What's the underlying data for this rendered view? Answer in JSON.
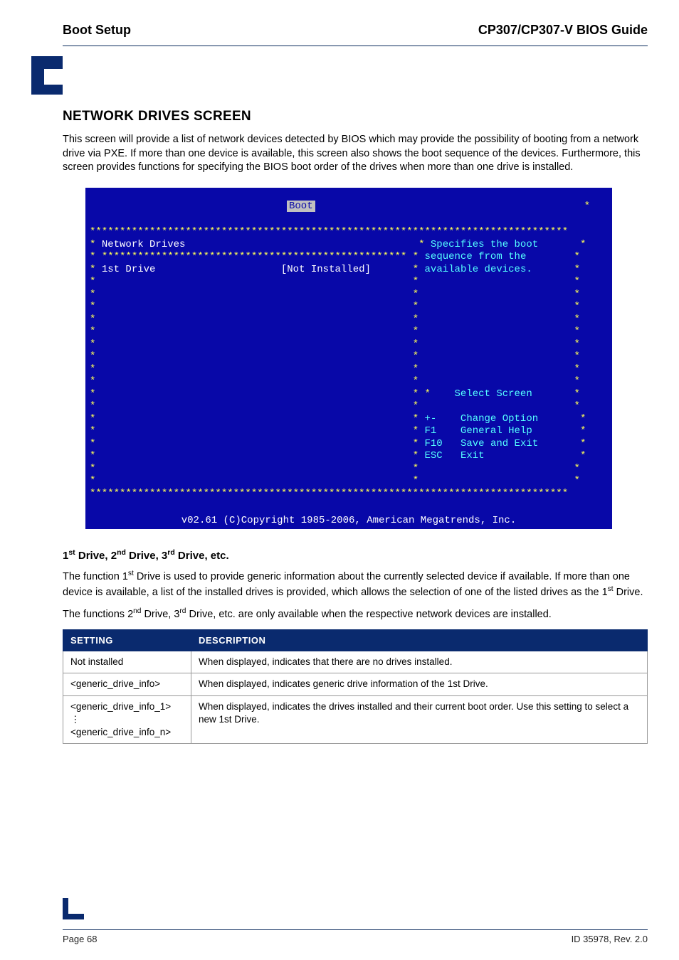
{
  "header": {
    "left": "Boot Setup",
    "right": "CP307/CP307-V BIOS Guide"
  },
  "section": {
    "title": "NETWORK DRIVES SCREEN",
    "intro": "This screen will provide a list of network devices detected by BIOS which may provide the possibility of booting from a network drive via PXE. If more than one device is available, this screen also shows the boot sequence of the devices. Furthermore, this screen provides functions for specifying the BIOS boot order of the drives when more than one drive is installed."
  },
  "bios": {
    "tab": "Boot",
    "panel_title": "Network Drives",
    "option_label": "1st Drive",
    "option_value": "[Not Installed]",
    "help1": "Specifies the boot",
    "help2": "sequence from the",
    "help3": "available devices.",
    "nav1": "Select Screen",
    "nav2_key": "+-",
    "nav2": "Change Option",
    "nav3_key": "F1",
    "nav3": "General Help",
    "nav4_key": "F10",
    "nav4": "Save and Exit",
    "nav5_key": "ESC",
    "nav5": "Exit",
    "copyright": "v02.61 (C)Copyright 1985-2006, American Megatrends, Inc."
  },
  "sub": {
    "title_html": "1st Drive, 2nd Drive, 3rd Drive, etc.",
    "p1a": "The function 1",
    "p1b": " Drive is used to provide generic information about the currently selected device if available. If more than one device is available, a list of the installed drives is provided, which allows the selection of one of the listed drives as the 1",
    "p1c": " Drive.",
    "p2a": "The functions 2",
    "p2b": " Drive, 3",
    "p2c": " Drive, etc. are only available when the respective network devices are installed."
  },
  "table": {
    "h1": "SETTING",
    "h2": "DESCRIPTION",
    "rows": [
      {
        "s": "Not installed",
        "d": "When displayed, indicates that there are no drives installed."
      },
      {
        "s": "<generic_drive_info>",
        "d": "When displayed, indicates generic drive information of the 1st Drive."
      },
      {
        "s": "<generic_drive_info_1>\n⋮\n<generic_drive_info_n>",
        "d": "When displayed, indicates the drives installed and their current boot order. Use this setting to select a new 1st Drive."
      }
    ]
  },
  "footer": {
    "left": "Page 68",
    "right": "ID 35978, Rev. 2.0"
  }
}
